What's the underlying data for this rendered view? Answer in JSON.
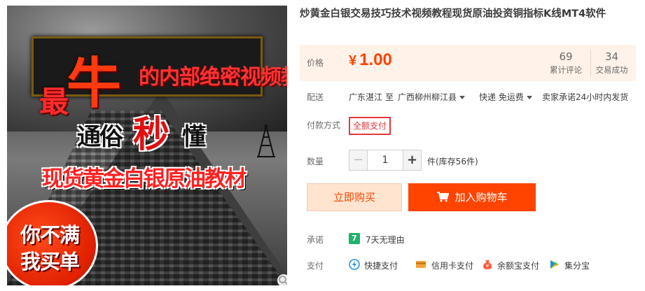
{
  "gallery": {
    "banner_line1_big": "牛",
    "banner_line1_prefix": "最",
    "banner_line1_rest": "的内部绝密视频教程",
    "banner_line2_a": "通俗",
    "banner_line2_b": "秒",
    "banner_line2_c": "懂",
    "banner_line3": "现货黄金白银原油教材",
    "badge_line1": "你不满",
    "badge_line2": "我买单"
  },
  "product": {
    "title": "炒黄金白银交易技巧技术视频教程现货原油投资铜指标K线MT4软件"
  },
  "price": {
    "label": "价格",
    "currency": "¥",
    "amount": "1.00",
    "comments_count": "69",
    "comments_label": "累计评论",
    "deals_count": "34",
    "deals_label": "交易成功"
  },
  "shipping": {
    "label": "配送",
    "from": "广东湛江",
    "to_word": "至",
    "destination": "广西柳州柳江县",
    "method": "快递 免运费",
    "promise": "卖家承诺24小时内发货"
  },
  "payment_method": {
    "label": "付款方式",
    "option": "全额支付"
  },
  "quantity": {
    "label": "数量",
    "minus": "−",
    "value": "1",
    "plus": "+",
    "stock": "件(库存56件)"
  },
  "actions": {
    "buy_now": "立即购买",
    "add_to_cart": "加入购物车"
  },
  "promise": {
    "label": "承诺",
    "icon_text": "7",
    "text": "7天无理由"
  },
  "payment": {
    "label": "支付",
    "items": [
      "快捷支付",
      "信用卡支付",
      "余额宝支付",
      "集分宝"
    ]
  },
  "colors": {
    "accent": "#ff4400",
    "price_bg": "#fff2e8",
    "buy_bg": "#ffe4d0",
    "promise_green": "#1fb36a"
  }
}
